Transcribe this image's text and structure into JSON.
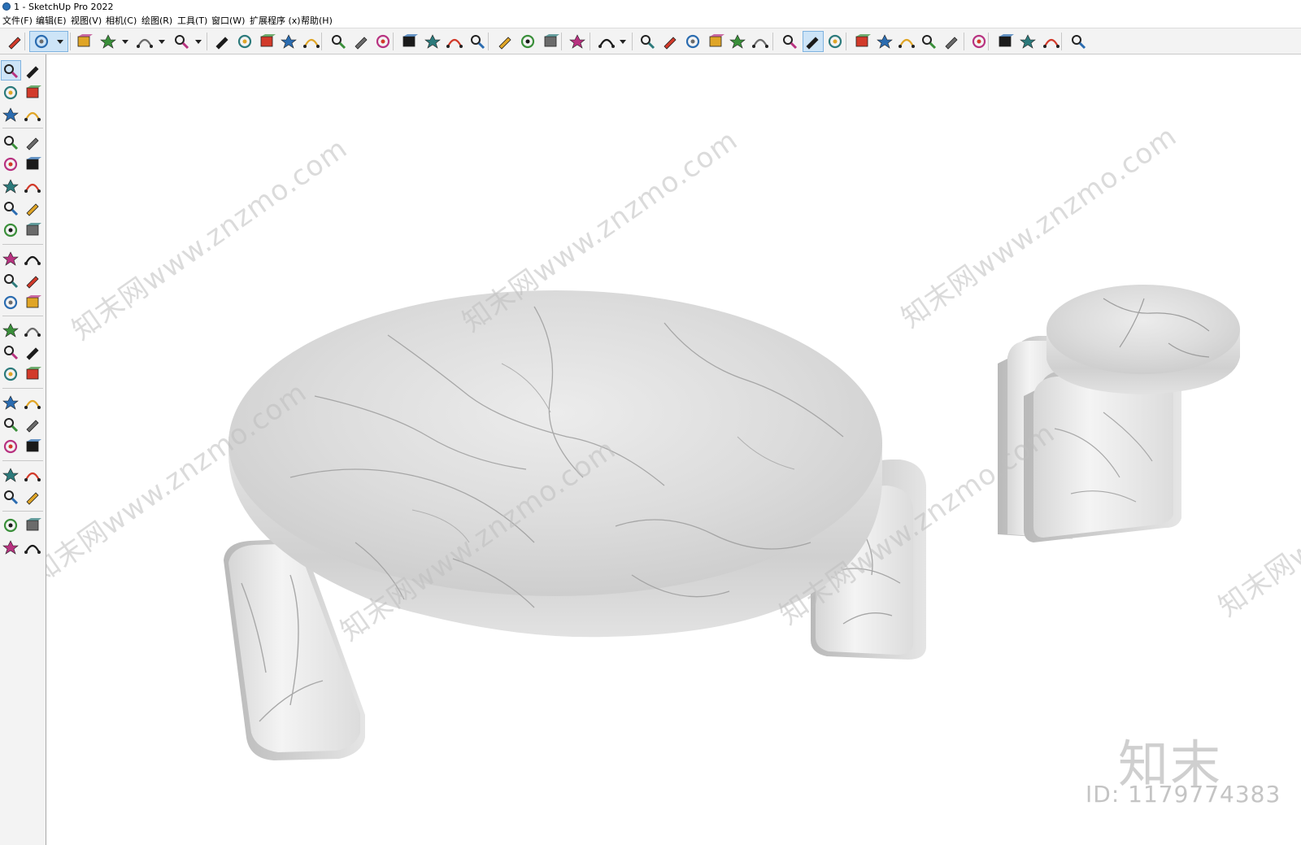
{
  "window": {
    "title": "1 - SketchUp Pro 2022"
  },
  "menu": [
    {
      "id": "file",
      "label": "文件(F)"
    },
    {
      "id": "edit",
      "label": "编辑(E)"
    },
    {
      "id": "view",
      "label": "视图(V)"
    },
    {
      "id": "camera",
      "label": "相机(C)"
    },
    {
      "id": "draw",
      "label": "绘图(R)"
    },
    {
      "id": "tools",
      "label": "工具(T)"
    },
    {
      "id": "window",
      "label": "窗口(W)"
    },
    {
      "id": "extensions",
      "label": "扩展程序 (x)"
    },
    {
      "id": "help",
      "label": "帮助(H)"
    }
  ],
  "top_toolbar_icons": [
    "search-icon",
    "select-icon",
    "eraser-icon",
    "pencil-icon",
    "arc-icon",
    "rectangle-icon",
    "push-pull-icon",
    "follow-me-icon",
    "move-icon",
    "rotate-icon",
    "scale-icon",
    "tape-measure-icon",
    "text-icon",
    "paint-bucket-icon",
    "orbit-icon",
    "pan-icon",
    "zoom-icon",
    "zoom-extents-icon",
    "section-plane-icon",
    "tags-icon",
    "outliner-icon",
    "layers-icon",
    "user-icon",
    "iso-view-icon",
    "front-view-icon",
    "home-view-icon",
    "right-view-icon",
    "back-view-icon",
    "top-view-icon",
    "warehouse-icon",
    "solid-tools-icon",
    "style-builder-icon",
    "component-icon",
    "add-location-icon",
    "shadow-icon",
    "texture-icon",
    "match-photo-icon",
    "cloud-icon",
    "settings-icon",
    "scenes-icon",
    "info-icon",
    "cart-icon",
    "profile-icon"
  ],
  "left_toolbar_icons": [
    "select-icon",
    "orbit-icon",
    "paint-bucket-icon",
    "eraser-icon",
    "component-icon",
    "tape-icon",
    "pencil-icon",
    "freehand-icon",
    "rectangle-icon",
    "rotated-rectangle-icon",
    "circle-icon",
    "polygon-icon",
    "arc-icon",
    "pie-icon",
    "two-point-arc-icon",
    "three-point-arc-icon",
    "move-icon",
    "push-pull-icon",
    "rotate-icon",
    "follow-me-icon",
    "scale-icon",
    "offset-icon",
    "tape-measure-icon",
    "dimension-icon",
    "protractor-icon",
    "text-icon",
    "axes-icon",
    "3d-text-icon",
    "orbit2-icon",
    "pan-icon",
    "zoom-icon",
    "zoom-window-icon",
    "zoom-extents-icon",
    "previous-view-icon",
    "position-camera-icon",
    "look-around-icon",
    "walk-icon",
    "section-plane-icon",
    "tags-icon",
    "outliner-icon",
    "layers-icon",
    "styles-icon"
  ],
  "watermarks": [
    "知末网www.znzmo.com",
    "知末网www.znzmo.com",
    "知末网www.znzmo.com",
    "知末网www.znzmo.com",
    "知末网www.znzmo.com",
    "知末网www.znzmo.com",
    "知末网www.znzmo.com"
  ],
  "brand": {
    "logo_text": "知末",
    "id_text": "ID: 1179774383"
  },
  "colors": {
    "marble_light": "#f2f2f2",
    "marble_mid": "#d4d4d4",
    "marble_dark": "#9a9a9a",
    "toolbar_bg": "#f3f3f3",
    "active_blue": "#cde4f7"
  }
}
